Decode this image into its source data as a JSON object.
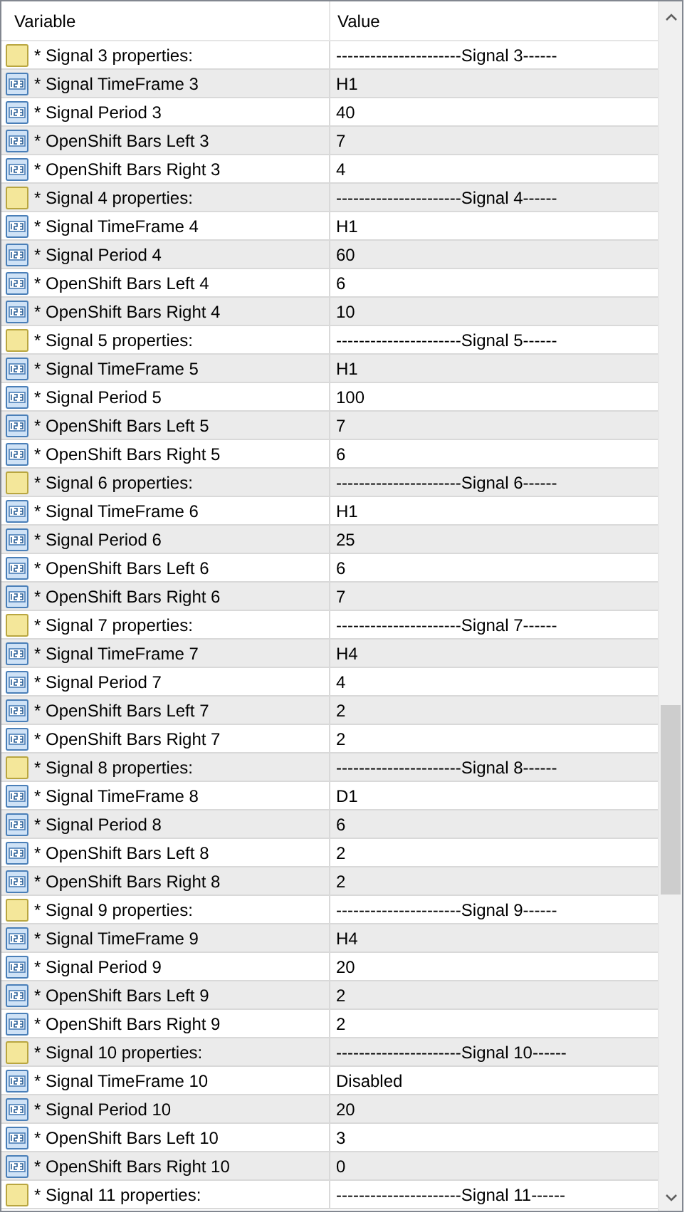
{
  "columns": [
    "Variable",
    "Value"
  ],
  "rows": [
    {
      "kind": "text",
      "name": "* Signal 3 properties:",
      "value": "----------------------Signal 3------"
    },
    {
      "kind": "number",
      "name": "* Signal TimeFrame 3",
      "value": "H1"
    },
    {
      "kind": "number",
      "name": "* Signal Period 3",
      "value": "40"
    },
    {
      "kind": "number",
      "name": "* OpenShift Bars Left 3",
      "value": "7"
    },
    {
      "kind": "number",
      "name": "* OpenShift Bars Right 3",
      "value": "4"
    },
    {
      "kind": "text",
      "name": "* Signal 4 properties:",
      "value": "----------------------Signal 4------"
    },
    {
      "kind": "number",
      "name": "* Signal TimeFrame 4",
      "value": "H1"
    },
    {
      "kind": "number",
      "name": "* Signal Period 4",
      "value": "60"
    },
    {
      "kind": "number",
      "name": "* OpenShift Bars Left 4",
      "value": "6"
    },
    {
      "kind": "number",
      "name": "* OpenShift Bars Right 4",
      "value": "10"
    },
    {
      "kind": "text",
      "name": "* Signal 5 properties:",
      "value": "----------------------Signal 5------"
    },
    {
      "kind": "number",
      "name": "* Signal TimeFrame 5",
      "value": "H1"
    },
    {
      "kind": "number",
      "name": "* Signal Period 5",
      "value": "100"
    },
    {
      "kind": "number",
      "name": "* OpenShift Bars Left 5",
      "value": "7"
    },
    {
      "kind": "number",
      "name": "* OpenShift Bars Right 5",
      "value": "6"
    },
    {
      "kind": "text",
      "name": "* Signal 6 properties:",
      "value": "----------------------Signal 6------"
    },
    {
      "kind": "number",
      "name": "* Signal TimeFrame 6",
      "value": "H1"
    },
    {
      "kind": "number",
      "name": "* Signal Period 6",
      "value": "25"
    },
    {
      "kind": "number",
      "name": "* OpenShift Bars Left 6",
      "value": "6"
    },
    {
      "kind": "number",
      "name": "* OpenShift Bars Right 6",
      "value": "7"
    },
    {
      "kind": "text",
      "name": "* Signal 7 properties:",
      "value": "----------------------Signal 7------"
    },
    {
      "kind": "number",
      "name": "* Signal TimeFrame 7",
      "value": "H4"
    },
    {
      "kind": "number",
      "name": "* Signal Period 7",
      "value": "4"
    },
    {
      "kind": "number",
      "name": "* OpenShift Bars Left 7",
      "value": "2"
    },
    {
      "kind": "number",
      "name": "* OpenShift Bars Right 7",
      "value": "2"
    },
    {
      "kind": "text",
      "name": "* Signal 8 properties:",
      "value": "----------------------Signal 8------"
    },
    {
      "kind": "number",
      "name": "* Signal TimeFrame 8",
      "value": "D1"
    },
    {
      "kind": "number",
      "name": "* Signal Period 8",
      "value": "6"
    },
    {
      "kind": "number",
      "name": "* OpenShift Bars Left 8",
      "value": "2"
    },
    {
      "kind": "number",
      "name": "* OpenShift Bars Right 8",
      "value": "2"
    },
    {
      "kind": "text",
      "name": "* Signal 9 properties:",
      "value": "----------------------Signal 9------"
    },
    {
      "kind": "number",
      "name": "* Signal TimeFrame 9",
      "value": "H4"
    },
    {
      "kind": "number",
      "name": "* Signal Period 9",
      "value": "20"
    },
    {
      "kind": "number",
      "name": "* OpenShift Bars Left 9",
      "value": "2"
    },
    {
      "kind": "number",
      "name": "* OpenShift Bars Right 9",
      "value": "2"
    },
    {
      "kind": "text",
      "name": "* Signal 10 properties:",
      "value": "----------------------Signal 10------"
    },
    {
      "kind": "number",
      "name": "* Signal TimeFrame 10",
      "value": "Disabled"
    },
    {
      "kind": "number",
      "name": "* Signal Period 10",
      "value": "20"
    },
    {
      "kind": "number",
      "name": "* OpenShift Bars Left 10",
      "value": "3"
    },
    {
      "kind": "number",
      "name": "* OpenShift Bars Right 10",
      "value": "0"
    },
    {
      "kind": "text",
      "name": "* Signal 11 properties:",
      "value": "----------------------Signal 11------"
    }
  ]
}
